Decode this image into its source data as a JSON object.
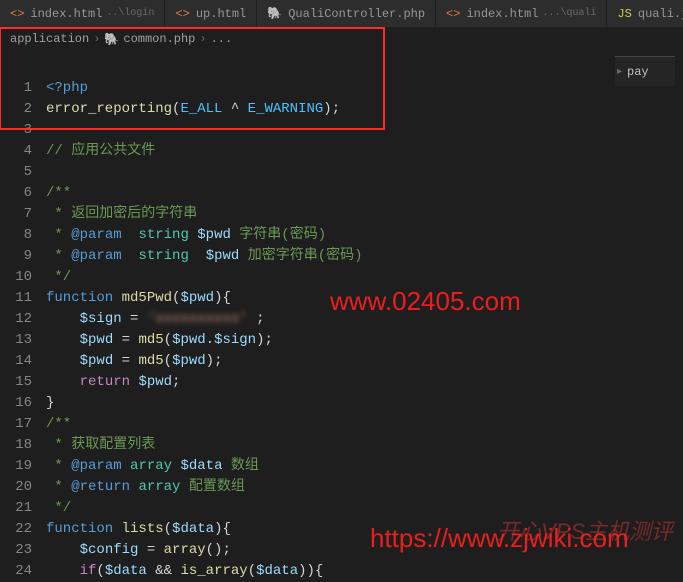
{
  "tabs": [
    {
      "label": "index.html",
      "sub": "..\\login",
      "icon": "html"
    },
    {
      "label": "up.html",
      "sub": "",
      "icon": "html"
    },
    {
      "label": "QualiController.php",
      "sub": "",
      "icon": "php"
    },
    {
      "label": "index.html",
      "sub": "...\\quali",
      "icon": "html"
    },
    {
      "label": "quali.js",
      "sub": "",
      "icon": "js"
    }
  ],
  "breadcrumb": {
    "seg1": "application",
    "seg2": "common.php",
    "seg3": "..."
  },
  "right_panel": {
    "label": "pay"
  },
  "code": {
    "l1": {
      "php_open": "<?php"
    },
    "l2": {
      "fn": "error_reporting",
      "c1": "E_ALL",
      "op": "^",
      "c2": "E_WARNING"
    },
    "l4": {
      "comment": "// 应用公共文件"
    },
    "l6": {
      "doc_open": "/**"
    },
    "l7": {
      "star": " * ",
      "text": "返回加密后的字符串"
    },
    "l8": {
      "star": " * ",
      "tag": "@param",
      "type": "string",
      "var": "$pwd",
      "desc": "字符串(密码)"
    },
    "l9": {
      "star": " * ",
      "tag": "@param",
      "type": "string",
      "var": "$pwd",
      "desc": "加密字符串(密码)"
    },
    "l10": {
      "doc_close": " */"
    },
    "l11": {
      "kw": "function",
      "name": "md5Pwd",
      "var": "$pwd"
    },
    "l12": {
      "var": "$sign",
      "blur": "'xxxxxxxxxx'"
    },
    "l13": {
      "var1": "$pwd",
      "fn": "md5",
      "var2": "$pwd",
      "var3": "$sign"
    },
    "l14": {
      "var1": "$pwd",
      "fn": "md5",
      "var2": "$pwd"
    },
    "l15": {
      "kw": "return",
      "var": "$pwd"
    },
    "l17": {
      "doc_open": "/**"
    },
    "l18": {
      "star": " * ",
      "text": "获取配置列表"
    },
    "l19": {
      "star": " * ",
      "tag": "@param",
      "type": "array",
      "var": "$data",
      "desc": "数组"
    },
    "l20": {
      "star": " * ",
      "tag": "@return",
      "type": "array",
      "desc": "配置数组"
    },
    "l21": {
      "doc_close": " */"
    },
    "l22": {
      "kw": "function",
      "name": "lists",
      "var": "$data"
    },
    "l23": {
      "var": "$config",
      "fn": "array"
    },
    "l24": {
      "kw": "if",
      "var1": "$data",
      "op": "&&",
      "fn": "is_array",
      "var2": "$data"
    }
  },
  "watermarks": {
    "w1": "www.02405.com",
    "w2": "https://www.zjwiki.com",
    "w3": "开心VPS主机测评"
  }
}
